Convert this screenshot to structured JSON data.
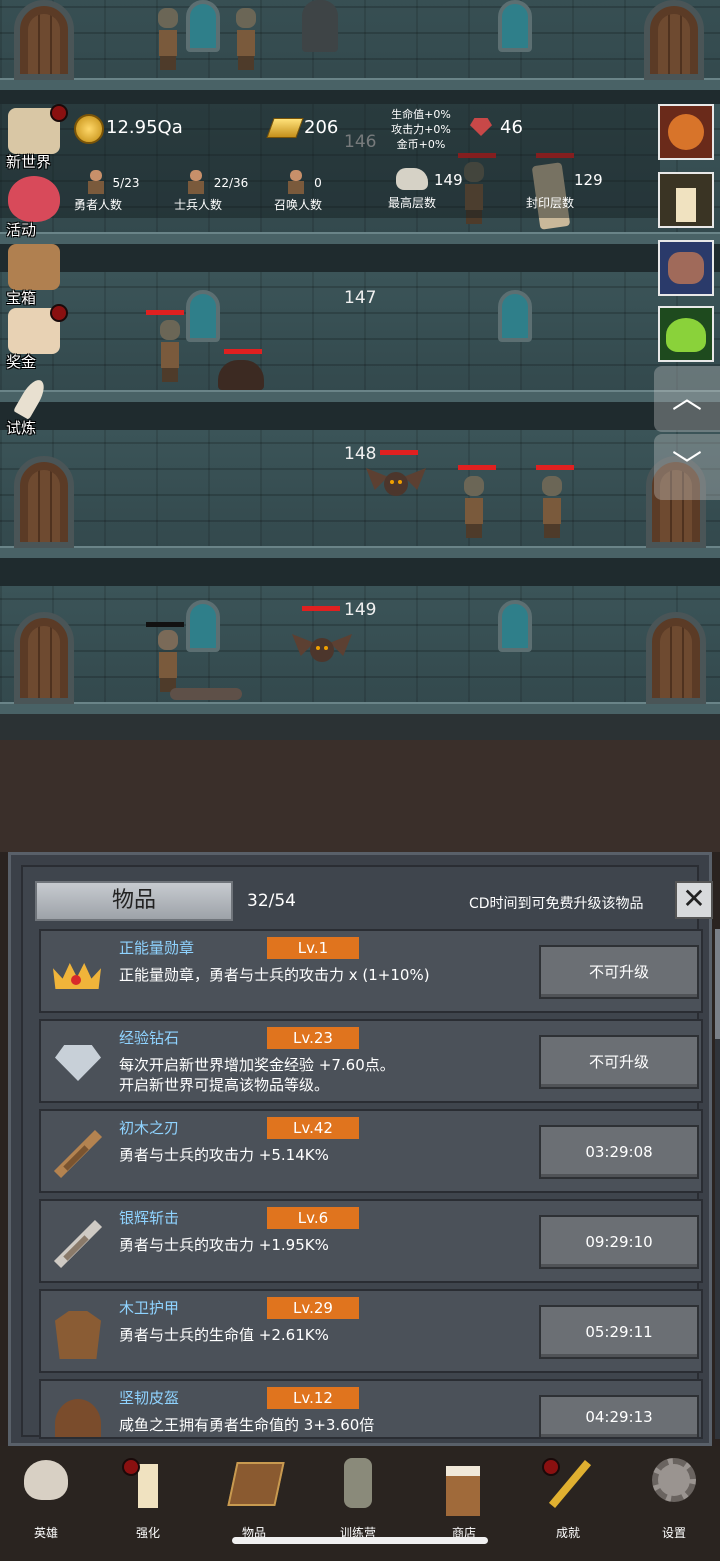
{
  "floors": [
    "146",
    "147",
    "148",
    "149"
  ],
  "resources": {
    "coins": "12.95Qa",
    "gold_bars": "206",
    "gems": "46",
    "bonus_lines": [
      "生命值+0%",
      "攻击力+0%",
      "金币+0%"
    ]
  },
  "stats": [
    {
      "value": "5/23",
      "label": "勇者人数"
    },
    {
      "value": "22/36",
      "label": "士兵人数"
    },
    {
      "value": "0",
      "label": "召唤人数"
    },
    {
      "value": "149",
      "label": "最高层数"
    },
    {
      "value": "129",
      "label": "封印层数"
    }
  ],
  "side_menu": [
    {
      "label": "新世界",
      "icon": "map-icon",
      "badge": true
    },
    {
      "label": "活动",
      "icon": "heart-icon",
      "badge": false
    },
    {
      "label": "宝箱",
      "icon": "chest-icon",
      "badge": false
    },
    {
      "label": "奖金",
      "icon": "envelope-icon",
      "badge": true
    },
    {
      "label": "试炼",
      "icon": "feather-icon",
      "badge": false
    }
  ],
  "right_menu": [
    {
      "icon": "fruit-icon",
      "color": "#d8372a"
    },
    {
      "icon": "candle-icon",
      "color": "#d8aa2a"
    },
    {
      "icon": "pig-icon",
      "color": "#3a6ad8"
    },
    {
      "icon": "slime-icon",
      "color": "#3ab83a"
    }
  ],
  "scroll_buttons": {
    "up": "︿",
    "down": "﹀"
  },
  "panel": {
    "title": "物品",
    "count": "32/54",
    "hint": "CD时间到可免费升级该物品",
    "close": "✕",
    "items": [
      {
        "name": "正能量勋章",
        "level": "Lv.1",
        "desc": "正能量勋章，勇者与士兵的攻击力 x (1+10%)",
        "button": "不可升级",
        "icon": "crown-icon"
      },
      {
        "name": "经验钻石",
        "level": "Lv.23",
        "desc": "每次开启新世界增加奖金经验 +7.60点。\n开启新世界可提高该物品等级。",
        "button": "不可升级",
        "icon": "diamond-icon"
      },
      {
        "name": "初木之刃",
        "level": "Lv.42",
        "desc": "勇者与士兵的攻击力 +5.14K%",
        "button": "03:29:08",
        "icon": "wooden-sword-icon"
      },
      {
        "name": "银辉斩击",
        "level": "Lv.6",
        "desc": "勇者与士兵的攻击力 +1.95K%",
        "button": "09:29:10",
        "icon": "silver-sword-icon"
      },
      {
        "name": "木卫护甲",
        "level": "Lv.29",
        "desc": "勇者与士兵的生命值 +2.61K%",
        "button": "05:29:11",
        "icon": "armor-icon"
      },
      {
        "name": "坚韧皮盔",
        "level": "Lv.12",
        "desc": "咸鱼之王拥有勇者生命值的 3+3.60倍",
        "button": "04:29:13",
        "icon": "helmet-icon"
      }
    ]
  },
  "nav": [
    {
      "label": "英雄",
      "icon": "skull-icon",
      "badge": false
    },
    {
      "label": "强化",
      "icon": "candle-icon",
      "badge": true
    },
    {
      "label": "物品",
      "icon": "book-icon",
      "badge": false
    },
    {
      "label": "训练营",
      "icon": "lantern-icon",
      "badge": false
    },
    {
      "label": "商店",
      "icon": "beer-icon",
      "badge": false
    },
    {
      "label": "成就",
      "icon": "key-icon",
      "badge": true
    },
    {
      "label": "设置",
      "icon": "gear-icon",
      "badge": false
    }
  ]
}
